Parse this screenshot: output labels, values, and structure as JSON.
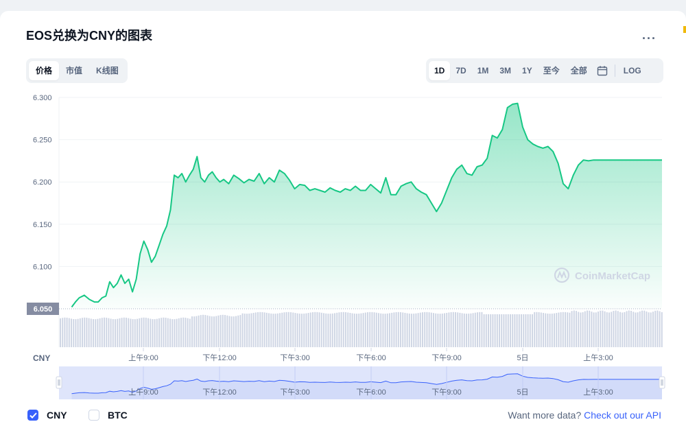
{
  "header": {
    "title": "EOS兑换为CNY的图表",
    "more_label": "..."
  },
  "tabs_left": [
    {
      "label": "价格",
      "active": true
    },
    {
      "label": "市值",
      "active": false
    },
    {
      "label": "K线图",
      "active": false
    }
  ],
  "tabs_right": [
    {
      "label": "1D",
      "active": true
    },
    {
      "label": "7D",
      "active": false
    },
    {
      "label": "1M",
      "active": false
    },
    {
      "label": "3M",
      "active": false
    },
    {
      "label": "1Y",
      "active": false
    },
    {
      "label": "至今",
      "active": false
    },
    {
      "label": "全部",
      "active": false
    }
  ],
  "calendar_icon": "calendar-icon",
  "log_label": "LOG",
  "colors": {
    "line": "#16c784",
    "navigator_line": "#3861fb",
    "navigator_fill": "#dfe5fb",
    "volume_bar": "#cfd6e4",
    "accent": "#3861fb"
  },
  "chart_data": {
    "type": "area",
    "currency_label": "CNY",
    "watermark": "CoinMarketCap",
    "ylim": [
      6.05,
      6.3
    ],
    "y_ticks": [
      "6.300",
      "6.250",
      "6.200",
      "6.150",
      "6.100"
    ],
    "baseline_label": "6.050",
    "x_tick_labels": [
      "上午9:00",
      "下午12:00",
      "下午3:00",
      "下午6:00",
      "下午9:00",
      "5日",
      "上午3:00"
    ],
    "x_hours": [
      0,
      6.3,
      9,
      12,
      15,
      18,
      21,
      24,
      27,
      29.6
    ],
    "series": [
      {
        "x": [
          6.3,
          6.45,
          6.6,
          6.8,
          7.0,
          7.2,
          7.35,
          7.5,
          7.65,
          7.8,
          7.95,
          8.1,
          8.25,
          8.4,
          8.55,
          8.7,
          8.85,
          9.0,
          9.15,
          9.3,
          9.45,
          9.6,
          9.75,
          9.9,
          10.05,
          10.2,
          10.35,
          10.5,
          10.65,
          10.8,
          10.95,
          11.1,
          11.25,
          11.4,
          11.55,
          11.7,
          11.85,
          12.0,
          12.15,
          12.3,
          12.5,
          12.7,
          12.9,
          13.1,
          13.3,
          13.5,
          13.7,
          13.9,
          14.1,
          14.3,
          14.5,
          14.7,
          14.9,
          15.1,
          15.3,
          15.5,
          15.7,
          15.9,
          16.1,
          16.3,
          16.5,
          16.7,
          16.9,
          17.1,
          17.3,
          17.5,
          17.7,
          17.9,
          18.1,
          18.3,
          18.5,
          18.7,
          18.9,
          19.1,
          19.3,
          19.5,
          19.7,
          19.9,
          20.1,
          20.3,
          20.5,
          20.7,
          20.9,
          21.1,
          21.3,
          21.5,
          21.7,
          21.9,
          22.1,
          22.3,
          22.5,
          22.7,
          22.9,
          23.1,
          23.3,
          23.5,
          23.7,
          23.9,
          24.1,
          24.3,
          24.5,
          24.7,
          24.9,
          25.1,
          25.3,
          25.5,
          25.7,
          25.9,
          26.1,
          26.3,
          26.5,
          26.7,
          26.9,
          27.1,
          27.3,
          27.5,
          27.7,
          27.9,
          28.1,
          28.3,
          28.5,
          28.7,
          28.9,
          29.1,
          29.3,
          29.5,
          29.6
        ],
        "y": [
          6.052,
          6.058,
          6.063,
          6.066,
          6.061,
          6.058,
          6.058,
          6.063,
          6.065,
          6.082,
          6.075,
          6.08,
          6.09,
          6.08,
          6.085,
          6.07,
          6.085,
          6.115,
          6.13,
          6.12,
          6.105,
          6.112,
          6.125,
          6.138,
          6.148,
          6.167,
          6.208,
          6.205,
          6.21,
          6.2,
          6.208,
          6.215,
          6.23,
          6.205,
          6.2,
          6.208,
          6.212,
          6.205,
          6.2,
          6.203,
          6.198,
          6.208,
          6.204,
          6.199,
          6.203,
          6.201,
          6.21,
          6.198,
          6.205,
          6.2,
          6.214,
          6.21,
          6.202,
          6.192,
          6.197,
          6.196,
          6.19,
          6.192,
          6.19,
          6.188,
          6.193,
          6.19,
          6.188,
          6.192,
          6.19,
          6.195,
          6.19,
          6.19,
          6.197,
          6.192,
          6.187,
          6.205,
          6.185,
          6.185,
          6.195,
          6.198,
          6.2,
          6.192,
          6.188,
          6.185,
          6.175,
          6.165,
          6.175,
          6.19,
          6.205,
          6.215,
          6.22,
          6.21,
          6.208,
          6.218,
          6.22,
          6.228,
          6.255,
          6.252,
          6.262,
          6.288,
          6.292,
          6.293,
          6.265,
          6.25,
          6.245,
          6.242,
          6.24,
          6.242,
          6.236,
          6.222,
          6.198,
          6.192,
          6.208,
          6.22,
          6.226,
          6.225,
          6.226,
          6.226,
          6.226,
          6.226,
          6.226,
          6.226,
          6.226,
          6.226,
          6.226,
          6.226,
          6.226,
          6.226,
          6.226,
          6.226,
          6.226
        ]
      }
    ]
  },
  "footer": {
    "cny_label": "CNY",
    "cny_checked": true,
    "btc_label": "BTC",
    "btc_checked": false,
    "api_text": "Want more data?",
    "api_link": "Check out our API"
  }
}
